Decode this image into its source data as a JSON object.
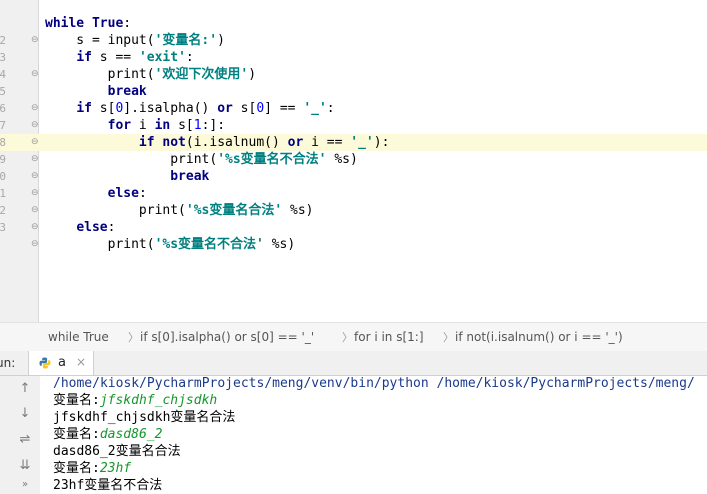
{
  "editor": {
    "line_numbers": [
      "",
      "",
      "2",
      "3",
      "4",
      "5",
      "6",
      "7",
      "8",
      "9",
      "0",
      "1",
      "2",
      "3"
    ],
    "highlight_line": 8,
    "lines": [
      [],
      [
        {
          "t": "kw",
          "v": "while"
        },
        {
          "t": "",
          "v": " "
        },
        {
          "t": "kw",
          "v": "True"
        },
        {
          "t": "",
          "v": ":"
        }
      ],
      [
        {
          "t": "",
          "v": "    s = input("
        },
        {
          "t": "st",
          "v": "'变量名:'"
        },
        {
          "t": "",
          "v": ")"
        }
      ],
      [
        {
          "t": "",
          "v": "    "
        },
        {
          "t": "kw",
          "v": "if"
        },
        {
          "t": "",
          "v": " s == "
        },
        {
          "t": "st",
          "v": "'exit'"
        },
        {
          "t": "",
          "v": ":"
        }
      ],
      [
        {
          "t": "",
          "v": "        print("
        },
        {
          "t": "st",
          "v": "'欢迎下次使用'"
        },
        {
          "t": "",
          "v": ")"
        }
      ],
      [
        {
          "t": "",
          "v": "        "
        },
        {
          "t": "kw",
          "v": "break"
        }
      ],
      [
        {
          "t": "",
          "v": "    "
        },
        {
          "t": "kw",
          "v": "if"
        },
        {
          "t": "",
          "v": " s["
        },
        {
          "t": "nm",
          "v": "0"
        },
        {
          "t": "",
          "v": "].isalpha() "
        },
        {
          "t": "kw",
          "v": "or"
        },
        {
          "t": "",
          "v": " s["
        },
        {
          "t": "nm",
          "v": "0"
        },
        {
          "t": "",
          "v": "] == "
        },
        {
          "t": "st",
          "v": "'_'"
        },
        {
          "t": "",
          "v": ":"
        }
      ],
      [
        {
          "t": "",
          "v": "        "
        },
        {
          "t": "kw",
          "v": "for"
        },
        {
          "t": "",
          "v": " i "
        },
        {
          "t": "kw",
          "v": "in"
        },
        {
          "t": "",
          "v": " s["
        },
        {
          "t": "nm",
          "v": "1"
        },
        {
          "t": "",
          "v": ":]:"
        }
      ],
      [
        {
          "t": "",
          "v": "            "
        },
        {
          "t": "kw",
          "v": "if"
        },
        {
          "t": "",
          "v": " "
        },
        {
          "t": "kw",
          "v": "not"
        },
        {
          "t": "",
          "v": "(i.isalnum() "
        },
        {
          "t": "kw",
          "v": "or"
        },
        {
          "t": "",
          "v": " i == "
        },
        {
          "t": "st",
          "v": "'_'"
        },
        {
          "t": "",
          "v": "):"
        }
      ],
      [
        {
          "t": "",
          "v": "                print("
        },
        {
          "t": "st",
          "v": "'%s变量名不合法'"
        },
        {
          "t": "",
          "v": " %s)"
        }
      ],
      [
        {
          "t": "",
          "v": "                "
        },
        {
          "t": "kw",
          "v": "break"
        }
      ],
      [
        {
          "t": "",
          "v": "        "
        },
        {
          "t": "kw",
          "v": "else"
        },
        {
          "t": "",
          "v": ":"
        }
      ],
      [
        {
          "t": "",
          "v": "            print("
        },
        {
          "t": "st",
          "v": "'%s变量名合法'"
        },
        {
          "t": "",
          "v": " %s)"
        }
      ],
      [
        {
          "t": "",
          "v": "    "
        },
        {
          "t": "kw",
          "v": "else"
        },
        {
          "t": "",
          "v": ":"
        }
      ],
      [
        {
          "t": "",
          "v": "        print("
        },
        {
          "t": "st",
          "v": "'%s变量名不合法'"
        },
        {
          "t": "",
          "v": " %s)"
        }
      ]
    ]
  },
  "breadcrumb": {
    "items": [
      "while True",
      "if s[0].isalpha() or s[0] == '_'",
      "for i in s[1:]",
      "if not(i.isalnum() or i == '_')"
    ]
  },
  "run_panel": {
    "label": "un:",
    "tab_name": "a",
    "tab_close": "×"
  },
  "console": {
    "lines": [
      [
        {
          "t": "path",
          "v": "/home/kiosk/PycharmProjects/meng/venv/bin/python /home/kiosk/PycharmProjects/meng/"
        }
      ],
      [
        {
          "t": "",
          "v": "变量名:"
        },
        {
          "t": "inp",
          "v": "jfskdhf_chjsdkh"
        }
      ],
      [
        {
          "t": "",
          "v": "jfskdhf_chjsdkh变量名合法"
        }
      ],
      [
        {
          "t": "",
          "v": "变量名:"
        },
        {
          "t": "inp",
          "v": "dasd86_2"
        }
      ],
      [
        {
          "t": "",
          "v": "dasd86_2变量名合法"
        }
      ],
      [
        {
          "t": "",
          "v": "变量名:"
        },
        {
          "t": "inp",
          "v": "23hf"
        }
      ],
      [
        {
          "t": "",
          "v": "23hf变量名不合法"
        }
      ]
    ]
  },
  "icons": {
    "up": "↑",
    "down": "↓",
    "wrap": "⇌",
    "scroll": "⇊",
    "print": "⎙",
    "more": "»"
  },
  "colors": {
    "keyword": "#000080",
    "string": "#008080",
    "number": "#0000ff",
    "console_input": "#14972c",
    "line_highlight": "#fcfad8"
  }
}
